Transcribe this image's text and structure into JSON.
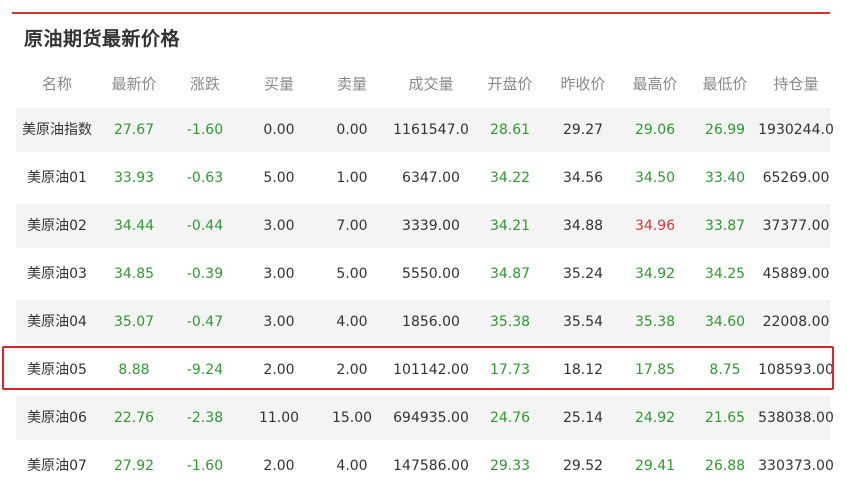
{
  "title": "原油期货最新价格",
  "colors": {
    "accent_rule": "#d9312b",
    "up": "#e8322a",
    "down": "#2e9b2e",
    "highlight_border": "#e0202a"
  },
  "table": {
    "headers": [
      "名称",
      "最新价",
      "涨跌",
      "买量",
      "卖量",
      "成交量",
      "开盘价",
      "昨收价",
      "最高价",
      "最低价",
      "持仓量"
    ],
    "rows": [
      {
        "name": "美原油指数",
        "latest": "27.67",
        "change": "-1.60",
        "buy": "0.00",
        "sell": "0.00",
        "volume": "1161547.0",
        "open": "28.61",
        "prev_close": "29.27",
        "high": "29.06",
        "low": "26.99",
        "open_interest": "1930244.0",
        "high_color": "green"
      },
      {
        "name": "美原油01",
        "latest": "33.93",
        "change": "-0.63",
        "buy": "5.00",
        "sell": "1.00",
        "volume": "6347.00",
        "open": "34.22",
        "prev_close": "34.56",
        "high": "34.50",
        "low": "33.40",
        "open_interest": "65269.00",
        "high_color": "green"
      },
      {
        "name": "美原油02",
        "latest": "34.44",
        "change": "-0.44",
        "buy": "3.00",
        "sell": "7.00",
        "volume": "3339.00",
        "open": "34.21",
        "prev_close": "34.88",
        "high": "34.96",
        "low": "33.87",
        "open_interest": "37377.00",
        "high_color": "red"
      },
      {
        "name": "美原油03",
        "latest": "34.85",
        "change": "-0.39",
        "buy": "3.00",
        "sell": "5.00",
        "volume": "5550.00",
        "open": "34.87",
        "prev_close": "35.24",
        "high": "34.92",
        "low": "34.25",
        "open_interest": "45889.00",
        "high_color": "green"
      },
      {
        "name": "美原油04",
        "latest": "35.07",
        "change": "-0.47",
        "buy": "3.00",
        "sell": "4.00",
        "volume": "1856.00",
        "open": "35.38",
        "prev_close": "35.54",
        "high": "35.38",
        "low": "34.60",
        "open_interest": "22008.00",
        "high_color": "green"
      },
      {
        "name": "美原油05",
        "latest": "8.88",
        "change": "-9.24",
        "buy": "2.00",
        "sell": "2.00",
        "volume": "101142.00",
        "open": "17.73",
        "prev_close": "18.12",
        "high": "17.85",
        "low": "8.75",
        "open_interest": "108593.00",
        "high_color": "green",
        "highlighted": true
      },
      {
        "name": "美原油06",
        "latest": "22.76",
        "change": "-2.38",
        "buy": "11.00",
        "sell": "15.00",
        "volume": "694935.00",
        "open": "24.76",
        "prev_close": "25.14",
        "high": "24.92",
        "low": "21.65",
        "open_interest": "538038.00",
        "high_color": "green"
      },
      {
        "name": "美原油07",
        "latest": "27.92",
        "change": "-1.60",
        "buy": "2.00",
        "sell": "4.00",
        "volume": "147586.00",
        "open": "29.33",
        "prev_close": "29.52",
        "high": "29.41",
        "low": "26.88",
        "open_interest": "330373.00",
        "high_color": "green"
      }
    ]
  }
}
